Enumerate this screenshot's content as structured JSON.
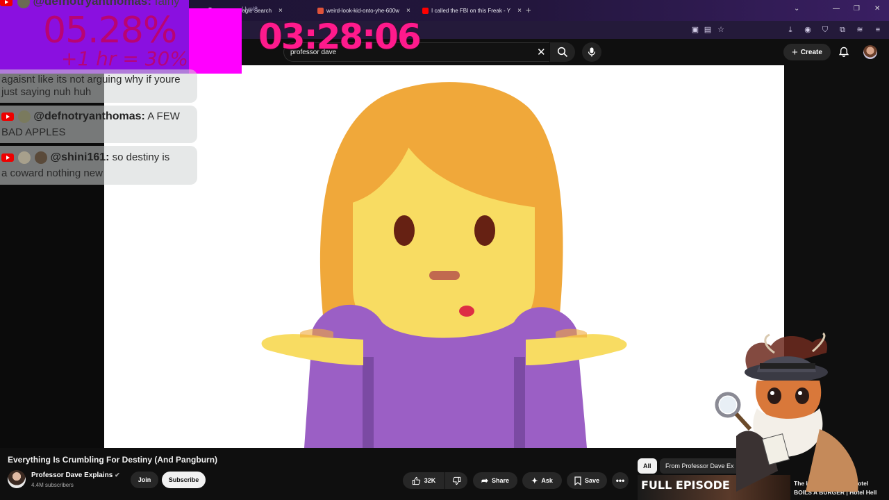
{
  "browser": {
    "tabs": [
      {
        "label": "...ook - Google Search",
        "color": "#ffffff"
      },
      {
        "label": "weird-look-kid-onto-yhe-600w",
        "color": "#e0533a"
      },
      {
        "label": "I called the FBI on this Freak - Y",
        "color": "#ff0000"
      }
    ],
    "address_fragment": "Uvpl8",
    "new_tab": "+"
  },
  "overlay": {
    "percent": "05.28%",
    "percent_sub": "+1 hr = 30%",
    "timer": "03:28:06",
    "top_user": "@defnotryanthomas:",
    "top_msg": "fainy",
    "chat": [
      {
        "user": "",
        "line1": "agaisnt like its not arguing why if youre",
        "line2": "just saying nuh huh"
      },
      {
        "user": "@defnotryanthomas:",
        "line1": "A FEW",
        "line2": "BAD APPLES"
      },
      {
        "user": "@shini161:",
        "line1": "so destiny is",
        "line2": "a coward nothing new"
      }
    ]
  },
  "youtube": {
    "search_query": "professor dave",
    "create_label": "Create",
    "video_title": "Everything Is Crumbling For Destiny (And Pangburn)",
    "channel_name": "Professor Dave Explains",
    "subscribers": "4.4M subscribers",
    "join": "Join",
    "subscribe": "Subscribe",
    "likes": "32K",
    "share": "Share",
    "ask": "Ask",
    "save": "Save",
    "chips": [
      "All",
      "From Professor Dave Ex"
    ],
    "rec_thumb_text": "FULL EPISODE",
    "rec_title": "The Infamous Where Hotel BOILS A BURGER | Hotel Hell"
  },
  "colors": {
    "hair": "#f0a83a",
    "skin": "#f8dc62",
    "shirt": "#9b5fc5",
    "accent_pink": "#ff1a8c",
    "overlay_purple": "#8a10e0"
  }
}
